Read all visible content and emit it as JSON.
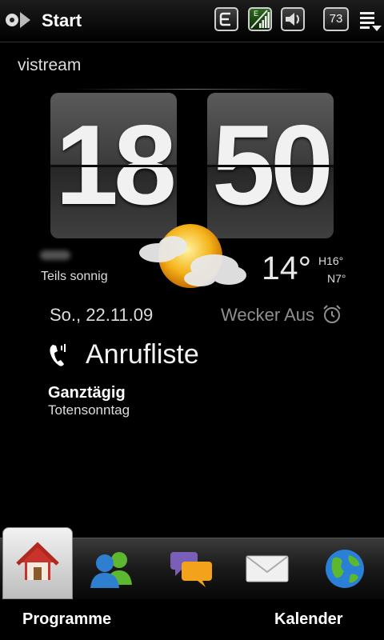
{
  "status_bar": {
    "title": "Start",
    "battery": "73",
    "network_label": "E"
  },
  "home": {
    "user_name": "vistream",
    "clock": {
      "hours": "18",
      "minutes": "50"
    },
    "weather": {
      "condition": "Teils sonnig",
      "temperature": "14°",
      "high": "H16°",
      "low": "N7°",
      "icon": "partly-sunny-icon"
    },
    "date": "So., 22.11.09",
    "alarm": "Wecker Aus",
    "calls_label": "Anrufliste",
    "event": {
      "title": "Ganztägig",
      "subtitle": "Totensonntag"
    }
  },
  "tabs": [
    {
      "name": "home",
      "icon": "house-icon",
      "active": true
    },
    {
      "name": "people",
      "icon": "people-icon",
      "active": false
    },
    {
      "name": "messages",
      "icon": "chat-bubbles-icon",
      "active": false
    },
    {
      "name": "mail",
      "icon": "envelope-icon",
      "active": false
    },
    {
      "name": "internet",
      "icon": "globe-icon",
      "active": false
    }
  ],
  "softkeys": {
    "left": "Programme",
    "right": "Kalender"
  }
}
